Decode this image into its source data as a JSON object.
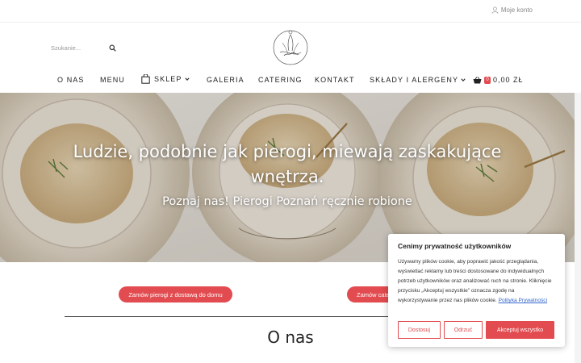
{
  "header": {
    "account_label": "Moje konto",
    "search_placeholder": "Szukanie..."
  },
  "nav": {
    "items": [
      "O NAS",
      "MENU",
      "SKLEP",
      "GALERIA",
      "CATERING",
      "KONTAKT",
      "SKŁADY I ALERGENY"
    ],
    "cart_count": "0",
    "cart_total": "0,00 ZŁ"
  },
  "hero": {
    "title": "Ludzie, podobnie jak pierogi, miewają zaskakujące wnętrza.",
    "subtitle": "Poznaj nas! Pierogi Poznań ręcznie robione"
  },
  "cta": {
    "delivery_label": "Zamów pierogi z dostawą do domu",
    "catering_label": "Zamów catering"
  },
  "about": {
    "title": "O nas"
  },
  "cookie": {
    "title": "Cenimy prywatność użytkowników",
    "body": "Używamy plików cookie, aby poprawić jakość przeglądania, wyświetlać reklamy lub treści dostosowane do indywidualnych potrzeb użytkowników oraz analizować ruch na stronie. Kliknięcie przycisku „Akceptuj wszystkie” oznacza zgodę na wykorzystywanie przez nas plików cookie.",
    "policy_link": "Polityka Prywatności",
    "customize_label": "Dostosuj",
    "reject_label": "Odrzuć",
    "accept_label": "Akceptuj wszystko"
  },
  "colors": {
    "accent": "#e24b4f",
    "text": "#222222",
    "link": "#3366cc"
  },
  "icons": [
    "user-icon",
    "search-icon",
    "logo-emblem",
    "shopping-bag-icon",
    "chevron-down-icon",
    "basket-icon",
    "fork-icon",
    "herb-icon"
  ]
}
